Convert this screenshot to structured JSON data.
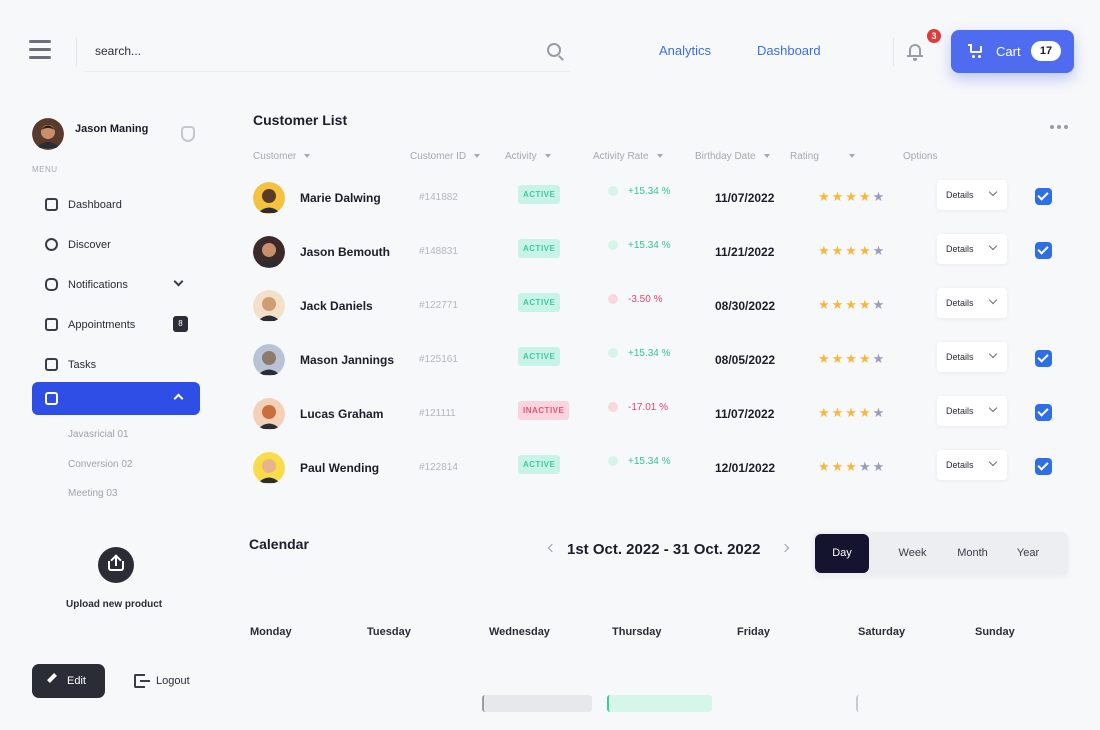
{
  "search": {
    "placeholder": "search..."
  },
  "nav": {
    "analytics": "Analytics",
    "dashboard": "Dashboard"
  },
  "notifications": {
    "count": "3"
  },
  "cart": {
    "label": "Cart",
    "count": "17"
  },
  "user": {
    "name": "Jason Maning"
  },
  "sidebar": {
    "menu_label": "MENU",
    "items": [
      {
        "label": "Dashboard"
      },
      {
        "label": "Discover"
      },
      {
        "label": "Notifications"
      },
      {
        "label": "Appointments",
        "count": "8"
      },
      {
        "label": "Tasks"
      },
      {
        "label": ""
      }
    ],
    "subitems": [
      "Javasricial 01",
      "Conversion 02",
      "Meeting 03"
    ],
    "upload_label": "Upload new product",
    "edit_label": "Edit",
    "logout_label": "Logout"
  },
  "customers": {
    "title": "Customer List",
    "columns": [
      "Customer",
      "Customer ID",
      "Activity",
      "Activity Rate",
      "Birthday Date",
      "Rating",
      "Options"
    ],
    "rows": [
      {
        "name": "Marie Dalwing",
        "id": "#141882",
        "status": "ACTIVE",
        "rate": "+15.34 %",
        "date": "11/07/2022",
        "stars": 4,
        "detail": "Details",
        "checked": true
      },
      {
        "name": "Jason Bemouth",
        "id": "#148831",
        "status": "ACTIVE",
        "rate": "+15.34 %",
        "date": "11/21/2022",
        "stars": 4,
        "detail": "Details",
        "checked": true
      },
      {
        "name": "Jack Daniels",
        "id": "#122771",
        "status": "ACTIVE",
        "rate": "-3.50 %",
        "date": "08/30/2022",
        "stars": 4,
        "detail": "Details",
        "checked": false
      },
      {
        "name": "Mason Jannings",
        "id": "#125161",
        "status": "ACTIVE",
        "rate": "+15.34 %",
        "date": "08/05/2022",
        "stars": 4,
        "detail": "Details",
        "checked": true
      },
      {
        "name": "Lucas Graham",
        "id": "#121111",
        "status": "INACTIVE",
        "rate": "-17.01 %",
        "date": "11/07/2022",
        "stars": 4,
        "detail": "Details",
        "checked": true
      },
      {
        "name": "Paul Wending",
        "id": "#122814",
        "status": "ACTIVE",
        "rate": "+15.34 %",
        "date": "12/01/2022",
        "stars": 3,
        "detail": "Details",
        "checked": true
      }
    ]
  },
  "calendar": {
    "title": "Calendar",
    "range": "1st Oct. 2022 - 31 Oct. 2022",
    "views": [
      "Day",
      "Week",
      "Month",
      "Year"
    ],
    "selected_view": "Day",
    "days": [
      "Monday",
      "Tuesday",
      "Wednesday",
      "Thursday",
      "Friday",
      "Saturday",
      "Sunday"
    ]
  }
}
